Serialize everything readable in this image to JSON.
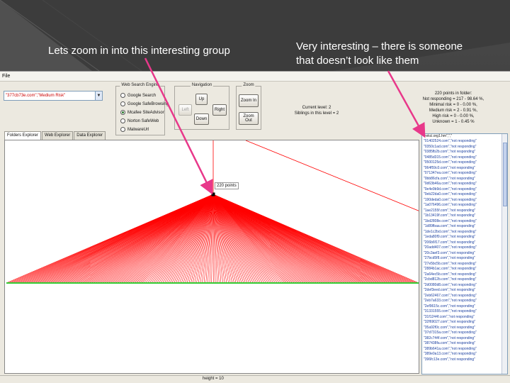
{
  "slide": {
    "caption_left": "Lets zoom in into this interesting group",
    "caption_right_line1": "Very interesting – there is someone",
    "caption_right_line2": "that doesn’t look like them"
  },
  "app": {
    "menu": {
      "file_label": "File"
    },
    "combo": {
      "value": "\"377cb73e.com\",\"Medium Risk\""
    },
    "web_search_engine": {
      "title": "Web Search Engine",
      "options": [
        {
          "label": "Google Search",
          "selected": false
        },
        {
          "label": "Google SafeBrowsing",
          "selected": false
        },
        {
          "label": "Mcafee SiteAdvisor",
          "selected": true
        },
        {
          "label": "Norton SafeWeb",
          "selected": false
        },
        {
          "label": "MalwareUrl",
          "selected": false
        }
      ]
    },
    "navigation": {
      "title": "Navigation",
      "up": "Up",
      "left": "Left",
      "right": "Right",
      "down": "Down"
    },
    "zoom": {
      "title": "Zoom",
      "zoom_in": "Zoom In",
      "zoom_out": "Zoom Out"
    },
    "level": {
      "current": "Current level: 2",
      "siblings": "Siblings in this level = 2"
    },
    "folder_info": {
      "line1": "220 points in folder:",
      "line2": "Not responding = 217 - 98.64 %,",
      "line3": "Minimal risk = 0 - 0.00 %,",
      "line4": "Medium risk = 2 - 0.91 %,",
      "line5": "High risk = 0 - 0.00 %,",
      "line6": "Unknown = 1 - 0.45 %"
    },
    "tabs": [
      "Folders Explorer",
      "Web Explorer",
      "Data Explorer"
    ],
    "canvas": {
      "point_label": "220 points"
    },
    "list": {
      "header": "\"rekci.org1.hm\",\",\"",
      "items": [
        "\"01402524.com\",\"not responding\"",
        "\"0350c1ad.com\",\"not responding\"",
        "\"0385fb2b.com\",\"not responding\"",
        "\"0485d315.com\",\"not responding\"",
        "\"0500125d.com\",\"not responding\"",
        "\"064f59c0.com\",\"not responding\"",
        "\"071347ea.com\",\"not responding\"",
        "\"0bb86cfa.com\",\"not responding\"",
        "\"0d63b46a.com\",\"not responding\"",
        "\"0e4e9b9d.com\",\"not responding\"",
        "\"0eb22da0.com\",\"not responding\"",
        "\"190deda0.com\",\"not responding\"",
        "\"1a076496.com\",\"not responding\"",
        "\"1ae2155f.com\",\"not responding\"",
        "\"1b13419f.com\",\"not responding\"",
        "\"1bd2808e.com\",\"not responding\"",
        "\"1d89fbaa.com\",\"not responding\"",
        "\"1de1c2bd.com\",\"not responding\"",
        "\"1eda80f9.com\",\"not responding\"",
        "\"206b6f17.com\",\"not responding\"",
        "\"20add407.com\",\"not responding\"",
        "\"20c3aef3.com\",\"not responding\"",
        "\"27bcd5f8.com\",\"not responding\"",
        "\"27e5bc5b.com\",\"not responding\"",
        "\"2884b1ac.com\",\"not responding\"",
        "\"2a64ec5b.com\",\"not responding\"",
        "\"2cbd812b.com\",\"not responding\"",
        "\"2d0080d8.com\",\"not responding\"",
        "\"2def3eed.com\",\"not responding\"",
        "\"2eb62467.com\",\"not responding\"",
        "\"2eb7a633.com\",\"not responding\"",
        "\"2ef9615c.com\",\"not responding\"",
        "\"31331555.com\",\"not responding\"",
        "\"31f1244f.com\",\"not responding\"",
        "\"32f69027.com\",\"not responding\"",
        "\"35a92f0c.com\",\"not responding\"",
        "\"37d7315a.com\",\"not responding\"",
        "\"382c744f.com\",\"not responding\"",
        "\"387438fa.com\",\"not responding\"",
        "\"389b641a.com\",\"not responding\"",
        "\"389e0a13.com\",\"not responding\"",
        "\"396fc13e.com\",\"not responding\""
      ]
    },
    "status": {
      "height": "height = 10"
    },
    "colors": {
      "tree_edges": "#ff0000",
      "leaf_nodes": "#33cc33",
      "callout_arrow": "#e8388a"
    }
  }
}
